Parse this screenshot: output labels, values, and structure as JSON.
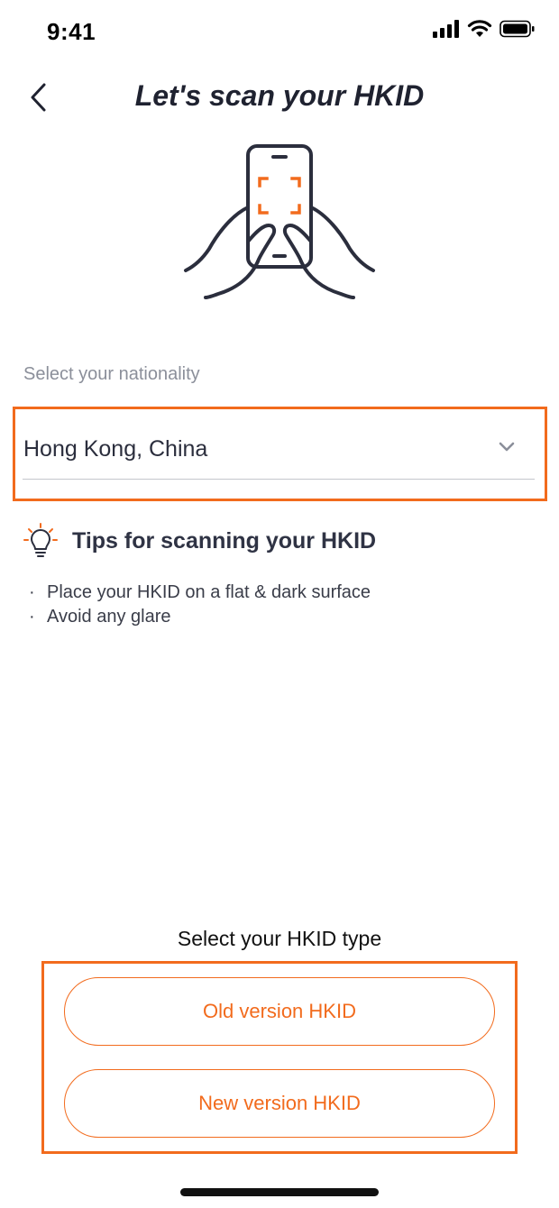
{
  "status_bar": {
    "time": "9:41",
    "icons": [
      "signal-icon",
      "wifi-icon",
      "battery-icon"
    ]
  },
  "header": {
    "back_icon": "chevron-left-icon",
    "title": "Let's scan your HKID"
  },
  "illustration": {
    "icon": "hands-holding-phone-scan-icon",
    "accent_color": "#f26b1d",
    "line_color": "#2b2e3d"
  },
  "nationality": {
    "label": "Select your nationality",
    "value": "Hong Kong, China",
    "dropdown_icon": "chevron-down-icon"
  },
  "tips": {
    "icon": "lightbulb-icon",
    "title": "Tips for scanning your HKID",
    "items": [
      "Place your HKID on a flat & dark surface",
      "Avoid any glare"
    ]
  },
  "hkid_type": {
    "label": "Select your HKID type",
    "options": [
      "Old version HKID",
      "New version HKID"
    ]
  },
  "colors": {
    "accent": "#f26b1d",
    "text_primary": "#2b2e3d",
    "text_muted": "#8b8f9a"
  }
}
